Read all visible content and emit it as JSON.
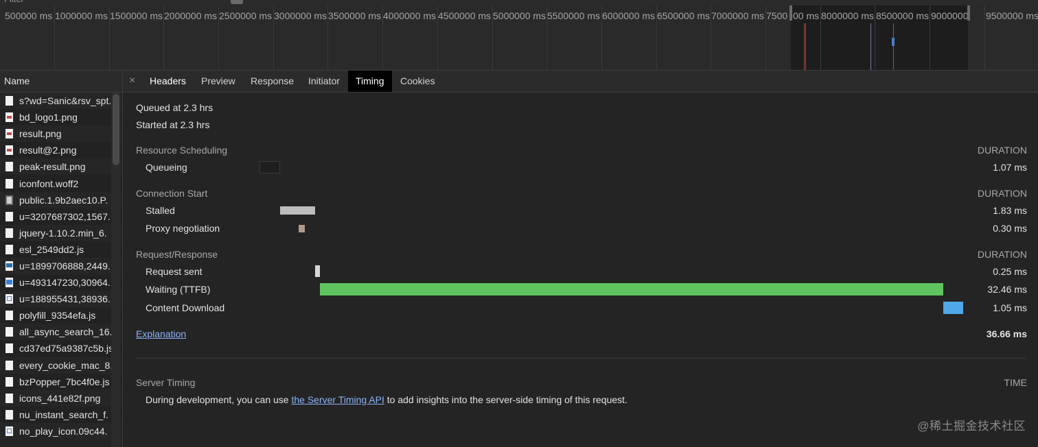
{
  "overview": {
    "tick_labels": [
      "500000 ms",
      "1000000 ms",
      "1500000 ms",
      "2000000 ms",
      "2500000 ms",
      "3000000 ms",
      "3500000 ms",
      "4000000 ms",
      "4500000 ms",
      "5000000 ms",
      "5500000 ms",
      "6000000 ms",
      "6500000 ms",
      "7000000 ms",
      "7500",
      "00 ms",
      "8000000 ms",
      "8500000 ms",
      "9000000",
      "9500000 ms"
    ]
  },
  "request_list": {
    "header": "Name",
    "items": [
      {
        "name": "s?wd=Sanic&rsv_spt.",
        "icon": "document-icon"
      },
      {
        "name": "bd_logo1.png",
        "icon": "image-file-icon"
      },
      {
        "name": "result.png",
        "icon": "image-file-icon"
      },
      {
        "name": "result@2.png",
        "icon": "image-file-icon"
      },
      {
        "name": "peak-result.png",
        "icon": "document-icon"
      },
      {
        "name": "iconfont.woff2",
        "icon": "document-icon"
      },
      {
        "name": "public.1.9b2aec10.P.",
        "icon": "dark-image-icon"
      },
      {
        "name": "u=3207687302,1567.",
        "icon": "document-icon"
      },
      {
        "name": "jquery-1.10.2.min_6.",
        "icon": "document-icon"
      },
      {
        "name": "esl_2549dd2.js",
        "icon": "document-icon"
      },
      {
        "name": "u=1899706888,2449.",
        "icon": "picture-icon"
      },
      {
        "name": "u=493147230,30964.",
        "icon": "blue-picture-icon"
      },
      {
        "name": "u=188955431,38936.",
        "icon": "grid-image-icon"
      },
      {
        "name": "polyfill_9354efa.js",
        "icon": "document-icon"
      },
      {
        "name": "all_async_search_16.",
        "icon": "document-icon"
      },
      {
        "name": "cd37ed75a9387c5b.js",
        "icon": "document-icon"
      },
      {
        "name": "every_cookie_mac_8.",
        "icon": "document-icon"
      },
      {
        "name": "bzPopper_7bc4f0e.js",
        "icon": "document-icon"
      },
      {
        "name": "icons_441e82f.png",
        "icon": "document-icon"
      },
      {
        "name": "nu_instant_search_f.",
        "icon": "document-icon"
      },
      {
        "name": "no_play_icon.09c44.",
        "icon": "grid-image-icon"
      }
    ]
  },
  "tabs": {
    "close_icon": "close-icon",
    "headers": "Headers",
    "preview": "Preview",
    "response": "Response",
    "initiator": "Initiator",
    "timing": "Timing",
    "cookies": "Cookies",
    "active": "Timing"
  },
  "timing": {
    "queued_at": "Queued at 2.3 hrs",
    "started_at": "Started at 2.3 hrs",
    "duration_header": "DURATION",
    "sections": {
      "resource_scheduling": {
        "title": "Resource Scheduling",
        "phases": [
          {
            "label": "Queueing",
            "duration": "1.07 ms",
            "start_ms": 0,
            "length_ms": 1.07,
            "color": "#1e1e1e"
          }
        ]
      },
      "connection_start": {
        "title": "Connection Start",
        "phases": [
          {
            "label": "Stalled",
            "duration": "1.83 ms",
            "start_ms": 1.07,
            "length_ms": 1.83,
            "color": "#bdbdbd"
          },
          {
            "label": "Proxy negotiation",
            "duration": "0.30 ms",
            "start_ms": 2.05,
            "length_ms": 0.3,
            "color": "#b09a8a"
          }
        ]
      },
      "request_response": {
        "title": "Request/Response",
        "phases": [
          {
            "label": "Request sent",
            "duration": "0.25 ms",
            "start_ms": 2.9,
            "length_ms": 0.25,
            "color": "#d6d6d6"
          },
          {
            "label": "Waiting (TTFB)",
            "duration": "32.46 ms",
            "start_ms": 3.15,
            "length_ms": 32.46,
            "color": "#5fc45f"
          },
          {
            "label": "Content Download",
            "duration": "1.05 ms",
            "start_ms": 35.61,
            "length_ms": 1.05,
            "color": "#4fa8e8"
          }
        ]
      }
    },
    "explanation_link": "Explanation",
    "total": "36.66 ms",
    "total_ms": 36.66
  },
  "server_timing": {
    "title": "Server Timing",
    "time_header": "TIME",
    "text_before": "During development, you can use ",
    "link": "the Server Timing API",
    "text_after": " to add insights into the server-side timing of this request."
  },
  "watermark": "@稀土掘金技术社区"
}
